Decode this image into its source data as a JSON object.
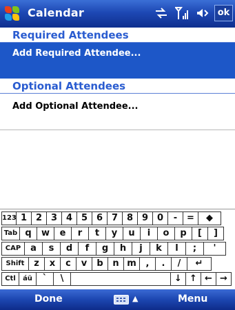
{
  "title_bar": {
    "app_title": "Calendar",
    "ok_label": "ok",
    "icons": [
      "windows-start-icon",
      "sync-icon",
      "signal-icon",
      "volume-icon"
    ]
  },
  "required": {
    "header": "Required Attendees",
    "add_label": "Add Required Attendee..."
  },
  "optional": {
    "header": "Optional Attendees",
    "add_label": "Add Optional Attendee..."
  },
  "keyboard": {
    "rows": [
      [
        "123",
        "1",
        "2",
        "3",
        "4",
        "5",
        "6",
        "7",
        "8",
        "9",
        "0",
        "-",
        "=",
        "◆"
      ],
      [
        "Tab",
        "q",
        "w",
        "e",
        "r",
        "t",
        "y",
        "u",
        "i",
        "o",
        "p",
        "[",
        "]"
      ],
      [
        "CAP",
        "a",
        "s",
        "d",
        "f",
        "g",
        "h",
        "j",
        "k",
        "l",
        ";",
        "'"
      ],
      [
        "Shift",
        "z",
        "x",
        "c",
        "v",
        "b",
        "n",
        "m",
        ",",
        ".",
        "/",
        "↵"
      ],
      [
        "Ctl",
        "áü",
        "`",
        "\\",
        "",
        "↓",
        "↑",
        "←",
        "→"
      ]
    ]
  },
  "menu_bar": {
    "left_softkey": "Done",
    "right_softkey": "Menu",
    "input_arrow": "▲"
  },
  "colors": {
    "title_bar": "#1d48b4",
    "selection": "#1d57c8",
    "section_header_text": "#2a5cd0"
  }
}
